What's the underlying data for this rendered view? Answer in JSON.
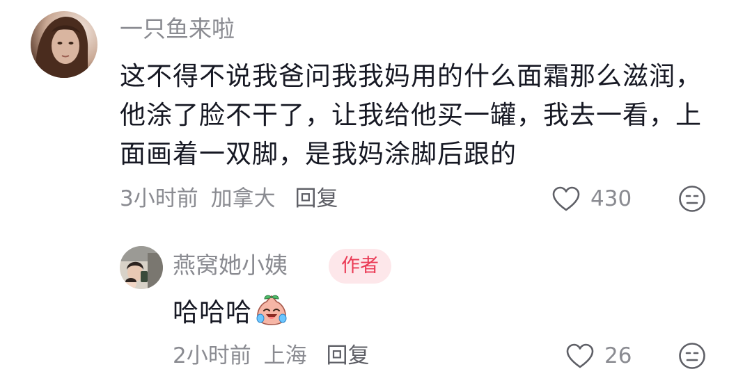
{
  "comment": {
    "username": "一只鱼来啦",
    "text": "这不得不说我爸问我我妈用的什么面霜那么滋润，他涂了脸不干了，让我给他买一罐，我去一看，上面画着一双脚，是我妈涂脚后跟的",
    "time": "3小时前",
    "location": "加拿大",
    "reply_label": "回复",
    "like_count": "430"
  },
  "reply": {
    "username": "燕窝她小姨",
    "badge": "作者",
    "text": "哈哈哈",
    "emoji": "laughing-crying-peach-emoji",
    "time": "2小时前",
    "location": "上海",
    "reply_label": "回复",
    "like_count": "26"
  },
  "colors": {
    "text_primary": "#161823",
    "text_secondary": "#8a8b91",
    "badge_bg": "#fde7ea",
    "badge_text": "#ea3a55"
  }
}
